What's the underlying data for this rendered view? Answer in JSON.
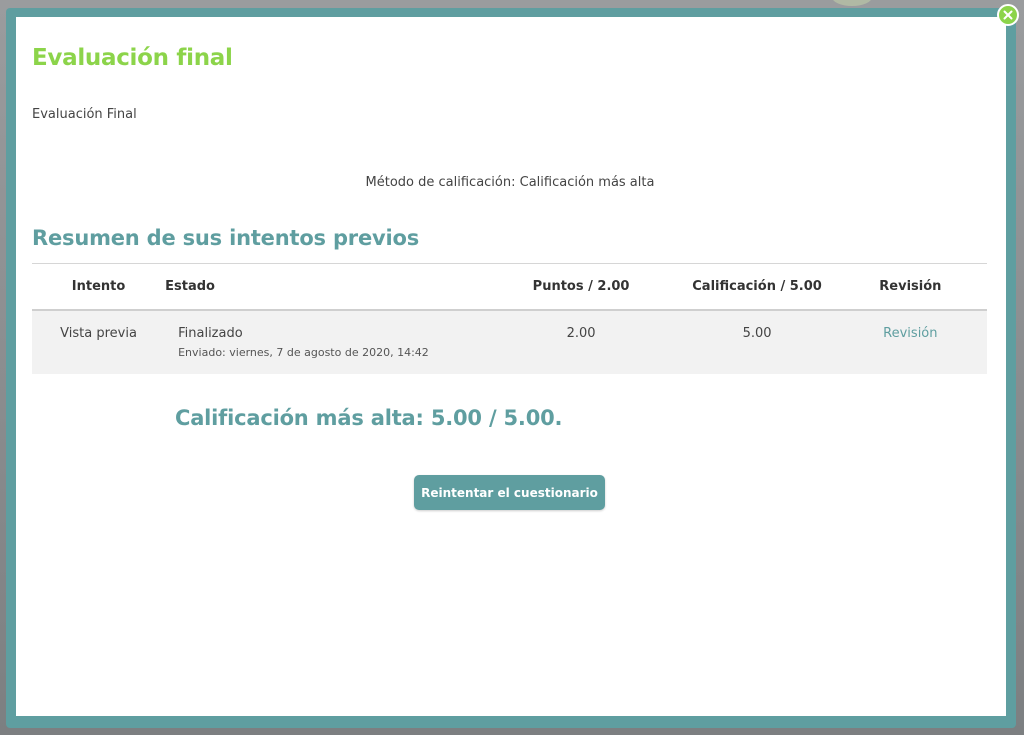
{
  "modal": {
    "title": "Evaluación final",
    "intro": "Evaluación Final",
    "method": "Método de calificación: Calificación más alta"
  },
  "summary": {
    "title": "Resumen de sus intentos previos",
    "headers": {
      "intento": "Intento",
      "estado": "Estado",
      "puntos": "Puntos / 2.00",
      "calificacion": "Calificación / 5.00",
      "revision": "Revisión"
    },
    "rows": [
      {
        "intento": "Vista previa",
        "estado": "Finalizado",
        "enviado": "Enviado: viernes, 7 de agosto de 2020, 14:42",
        "puntos": "2.00",
        "calificacion": "5.00",
        "revision": "Revisión"
      }
    ]
  },
  "highest": "Calificación más alta: 5.00 / 5.00.",
  "retry_label": "Reintentar el cuestionario",
  "colors": {
    "accent_green": "#8cd44a",
    "accent_teal": "#5f9ea0"
  },
  "icons": {
    "close": "close-icon"
  }
}
